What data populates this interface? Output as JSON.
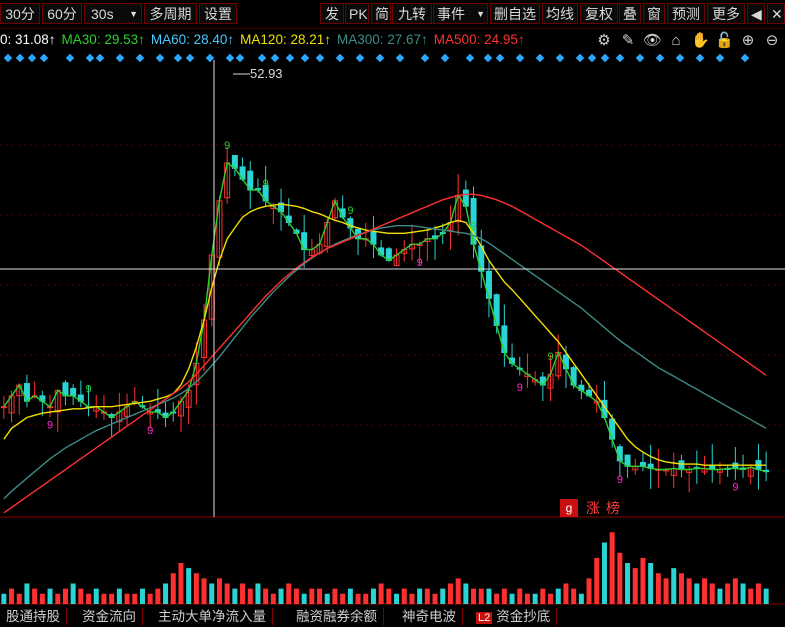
{
  "toolbar": {
    "left_buttons": [
      "30分",
      "60分",
      "30s",
      "多周期",
      "设置"
    ],
    "right_buttons": [
      "发",
      "PK",
      "简",
      "九转",
      "事件",
      "删自选",
      "均线",
      "复权",
      "叠",
      "窗",
      "预测",
      "更多"
    ],
    "period_dropdown_icon": "caret-down-icon",
    "event_dropdown_icon": "caret-down-icon",
    "nav_icon": "play-arrow-icon",
    "close_icon": "close-icon"
  },
  "ma_legend": [
    {
      "label": "0: 31.08↑",
      "color": "#ffffff"
    },
    {
      "label": "MA30: 29.53↑",
      "color": "#2bd02b"
    },
    {
      "label": "MA60: 28.40↑",
      "color": "#48c8ff"
    },
    {
      "label": "MA120: 28.21↑",
      "color": "#f0e000"
    },
    {
      "label": "MA300: 27.67↑",
      "color": "#3d8a86"
    },
    {
      "label": "MA500: 24.95↑",
      "color": "#ff3030"
    }
  ],
  "tool_icons": [
    "gear-icon",
    "pen-icon",
    "eye-icon",
    "lock-box-icon",
    "hand-icon",
    "unlock-icon",
    "zoom-in-icon",
    "zoom-out-icon"
  ],
  "peak_label": "52.93",
  "zhangbang": {
    "icon_text": "g",
    "label": "涨榜"
  },
  "bottom_tabs": [
    "股通持股",
    "资金流向",
    "主动大单净流入量",
    "融资融券余额",
    "神奇电波",
    "资金抄底"
  ],
  "bottom_tab_badge": "L2",
  "colors": {
    "up": "#ff3030",
    "down": "#2ad4d4",
    "crosshair": "#e0e0e0",
    "diamond": "#2aa8ff",
    "tdseq": "#ff2ad4"
  },
  "chart_data": {
    "type": "line",
    "title": "",
    "xlabel": "",
    "ylabel": "",
    "peak_value": 52.93,
    "ylim": [
      14,
      56
    ],
    "series": [
      {
        "name": "MA30",
        "color": "#2bd02b",
        "values": [
          24,
          25,
          26,
          24.5,
          25,
          24.5,
          24,
          25.5,
          25,
          25,
          24.5,
          24,
          24,
          23.5,
          23,
          23.5,
          24,
          24.5,
          24,
          23.5,
          23.5,
          23,
          23.5,
          24.5,
          25.5,
          28,
          32,
          38,
          43,
          46.5,
          46,
          45,
          44,
          44,
          43,
          42.5,
          42,
          41,
          40,
          38.5,
          38.5,
          39,
          41,
          43,
          41.5,
          40.5,
          39.5,
          39.5,
          39,
          38,
          37.5,
          38,
          38.5,
          39,
          39,
          39.5,
          39.5,
          40,
          41,
          43.5,
          42.5,
          39,
          36.5,
          34,
          31.5,
          29,
          28,
          27.5,
          27,
          26.5,
          26,
          27,
          29,
          27.5,
          26,
          25.5,
          25,
          24.5,
          23,
          21,
          19,
          18.5,
          18.5,
          18.5,
          18.3,
          18.2,
          18.2,
          18.3,
          18.2,
          18.2,
          18.3,
          18.3,
          18.2,
          18.2,
          18.3,
          18.3,
          18.2,
          18.4,
          18.2,
          18
        ]
      },
      {
        "name": "MA60",
        "color": "#48c8ff",
        "values": []
      },
      {
        "name": "MA120",
        "color": "#f0e000",
        "values": [
          21,
          22,
          22.5,
          23,
          23.2,
          23.4,
          23.5,
          23.6,
          23.7,
          23.8,
          23.8,
          23.9,
          24,
          24,
          24,
          24.1,
          24.2,
          24.3,
          24.4,
          24.5,
          24.7,
          24.9,
          25.2,
          26,
          27.5,
          29.5,
          32,
          35,
          37.5,
          39.5,
          40.5,
          41.5,
          42,
          42.3,
          42.5,
          42.6,
          42.7,
          42.6,
          42.5,
          42.3,
          42,
          41.8,
          41.5,
          41.2,
          41,
          40.7,
          40.5,
          40.3,
          40.2,
          40.1,
          40,
          40,
          40,
          40.1,
          40.2,
          40.3,
          40.5,
          40.7,
          41,
          41.2,
          41,
          40,
          38.8,
          37.5,
          36.5,
          35.5,
          34.8,
          34,
          33.2,
          32.4,
          31.6,
          30.8,
          30,
          29,
          28,
          27,
          26,
          25,
          24,
          23,
          22,
          21,
          20.3,
          19.8,
          19.4,
          19.1,
          18.9,
          18.8,
          18.7,
          18.7,
          18.7,
          18.6,
          18.6,
          18.6,
          18.6,
          18.6,
          18.6,
          18.6,
          18.6,
          18.6
        ]
      },
      {
        "name": "MA300",
        "color": "#3d8a86",
        "values": [
          15.5,
          16.2,
          16.8,
          17.4,
          18,
          18.6,
          19.2,
          19.7,
          20.2,
          20.6,
          21,
          21.4,
          21.8,
          22.1,
          22.4,
          22.7,
          23,
          23.3,
          23.6,
          23.9,
          24.2,
          24.5,
          24.8,
          25.2,
          25.7,
          26.3,
          27,
          27.8,
          28.6,
          29.5,
          30.4,
          31.3,
          32.2,
          33,
          33.8,
          34.6,
          35.3,
          36,
          36.6,
          37.2,
          37.7,
          38.2,
          38.6,
          39,
          39.3,
          39.6,
          39.9,
          40.1,
          40.3,
          40.5,
          40.6,
          40.7,
          40.7,
          40.7,
          40.6,
          40.5,
          40.4,
          40.3,
          40.2,
          40.1,
          40,
          39.8,
          39.5,
          39.1,
          38.6,
          38.1,
          37.6,
          37.1,
          36.6,
          36.1,
          35.6,
          35.1,
          34.6,
          34.1,
          33.6,
          33.1,
          32.5,
          31.9,
          31.3,
          30.7,
          30.1,
          29.6,
          29.1,
          28.6,
          28.1,
          27.6,
          27.2,
          26.8,
          26.4,
          26,
          25.6,
          25.2,
          24.8,
          24.4,
          24,
          23.6,
          23.2,
          22.8,
          22.4,
          22
        ]
      },
      {
        "name": "MA500",
        "color": "#ff3030",
        "values": [
          14.2,
          14.7,
          15.2,
          15.7,
          16.2,
          16.7,
          17.2,
          17.7,
          18.2,
          18.7,
          19.2,
          19.7,
          20.2,
          20.7,
          21.2,
          21.7,
          22.2,
          22.7,
          23.2,
          23.7,
          24.2,
          24.7,
          25.2,
          25.7,
          26.3,
          27,
          27.8,
          28.6,
          29.4,
          30.2,
          31,
          31.8,
          32.6,
          33.4,
          34.2,
          34.9,
          35.6,
          36.2,
          36.8,
          37.3,
          37.8,
          38.2,
          38.6,
          38.9,
          39.2,
          39.5,
          39.8,
          40.1,
          40.4,
          40.7,
          41,
          41.3,
          41.6,
          41.9,
          42.2,
          42.5,
          42.8,
          43.1,
          43.3,
          43.5,
          43.6,
          43.6,
          43.5,
          43.3,
          43.1,
          42.8,
          42.5,
          42.1,
          41.7,
          41.3,
          40.9,
          40.5,
          40.1,
          39.7,
          39.3,
          38.9,
          38.4,
          37.9,
          37.4,
          36.9,
          36.4,
          35.9,
          35.4,
          34.9,
          34.4,
          33.9,
          33.4,
          32.9,
          32.4,
          31.9,
          31.4,
          30.9,
          30.4,
          29.9,
          29.4,
          28.9,
          28.4,
          27.9,
          27.4,
          26.9
        ]
      }
    ],
    "td_sequential_marks": [
      {
        "i": 6,
        "label": "9",
        "color": "#ff2ad4"
      },
      {
        "i": 11,
        "label": "9",
        "color": "#2bd02b"
      },
      {
        "i": 19,
        "label": "9",
        "color": "#ff2ad4"
      },
      {
        "i": 29,
        "label": "9",
        "color": "#2bd02b"
      },
      {
        "i": 34,
        "label": "9",
        "color": "#2bd02b"
      },
      {
        "i": 45,
        "label": "9",
        "color": "#2bd02b"
      },
      {
        "i": 54,
        "label": "9",
        "color": "#ff2ad4"
      },
      {
        "i": 61,
        "label": "9",
        "color": "#2bd02b"
      },
      {
        "i": 67,
        "label": "9",
        "color": "#ff2ad4"
      },
      {
        "i": 71,
        "label": "9",
        "color": "#2bd02b"
      },
      {
        "i": 80,
        "label": "9",
        "color": "#ff2ad4"
      },
      {
        "i": 95,
        "label": "9",
        "color": "#ff2ad4"
      }
    ],
    "volume": [
      2,
      3,
      2,
      4,
      3,
      2,
      3,
      2,
      3,
      4,
      3,
      2,
      3,
      2,
      2,
      3,
      2,
      2,
      3,
      2,
      3,
      4,
      6,
      8,
      7,
      6,
      5,
      4,
      5,
      4,
      3,
      4,
      3,
      4,
      3,
      2,
      3,
      4,
      3,
      2,
      3,
      3,
      2,
      3,
      2,
      3,
      2,
      2,
      3,
      4,
      3,
      2,
      3,
      2,
      3,
      3,
      2,
      3,
      4,
      5,
      4,
      3,
      3,
      3,
      2,
      3,
      2,
      3,
      2,
      2,
      3,
      2,
      3,
      4,
      3,
      2,
      5,
      9,
      12,
      14,
      10,
      8,
      7,
      9,
      8,
      6,
      5,
      7,
      6,
      5,
      4,
      5,
      4,
      3,
      4,
      5,
      4,
      3,
      4,
      3
    ],
    "volume_ylim": [
      0,
      16
    ]
  }
}
